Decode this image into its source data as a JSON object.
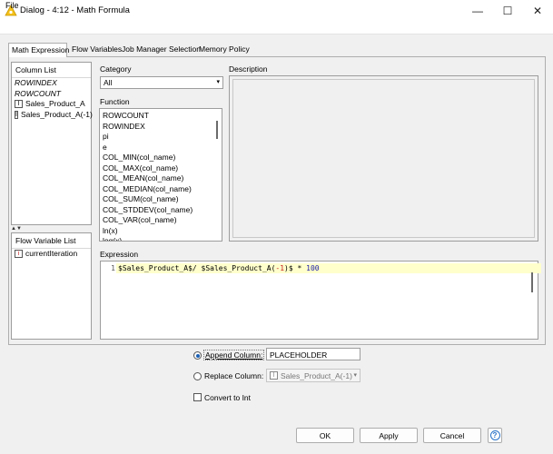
{
  "window": {
    "title": "Dialog - 4:12 - Math Formula",
    "controls": {
      "minimize": "—",
      "maximize": "☐",
      "close": "✕"
    }
  },
  "menu": {
    "file": "File"
  },
  "tabs": [
    {
      "label": "Math Expression",
      "active": true
    },
    {
      "label": "Flow Variables",
      "active": false
    },
    {
      "label": "Job Manager Selection",
      "active": false
    },
    {
      "label": "Memory Policy",
      "active": false
    }
  ],
  "column_list": {
    "header": "Column List",
    "items": [
      {
        "label": "ROWINDEX",
        "italic": true,
        "type": ""
      },
      {
        "label": "ROWCOUNT",
        "italic": true,
        "type": ""
      },
      {
        "label": "Sales_Product_A",
        "italic": false,
        "type": "I"
      },
      {
        "label": "Sales_Product_A(-1)",
        "italic": false,
        "type": "I"
      }
    ]
  },
  "splitter": {
    "arrows": "▲▼"
  },
  "flow_variable_list": {
    "header": "Flow Variable List",
    "items": [
      {
        "label": "currentIteration",
        "type": "i"
      }
    ]
  },
  "category": {
    "label": "Category",
    "value": "All"
  },
  "function": {
    "label": "Function",
    "items": [
      "ROWCOUNT",
      "ROWINDEX",
      "pi",
      "e",
      "COL_MIN(col_name)",
      "COL_MAX(col_name)",
      "COL_MEAN(col_name)",
      "COL_MEDIAN(col_name)",
      "COL_SUM(col_name)",
      "COL_STDDEV(col_name)",
      "COL_VAR(col_name)",
      "ln(x)",
      "log(x)"
    ]
  },
  "description": {
    "label": "Description"
  },
  "expression": {
    "label": "Expression",
    "line_number": "1",
    "tokens": [
      {
        "text": "$Sales_Product_A$/ $Sales_Product_A",
        "color": "#000000"
      },
      {
        "text": "(",
        "color": "#000000"
      },
      {
        "text": "-1",
        "color": "#c81e1e"
      },
      {
        "text": ")$",
        "color": "#000000"
      },
      {
        "text": " * ",
        "color": "#000000"
      },
      {
        "text": "100",
        "color": "#1a1aa8"
      }
    ],
    "highlight_color": "#ffffcc"
  },
  "options": {
    "append_label": "Append Column:",
    "append_value": "PLACEHOLDER",
    "replace_label": "Replace Column:",
    "replace_value": "Sales_Product_A(-1)",
    "replace_type": "I",
    "convert_label": "Convert to Int"
  },
  "buttons": {
    "ok": "OK",
    "apply": "Apply",
    "cancel": "Cancel",
    "help": "?"
  }
}
